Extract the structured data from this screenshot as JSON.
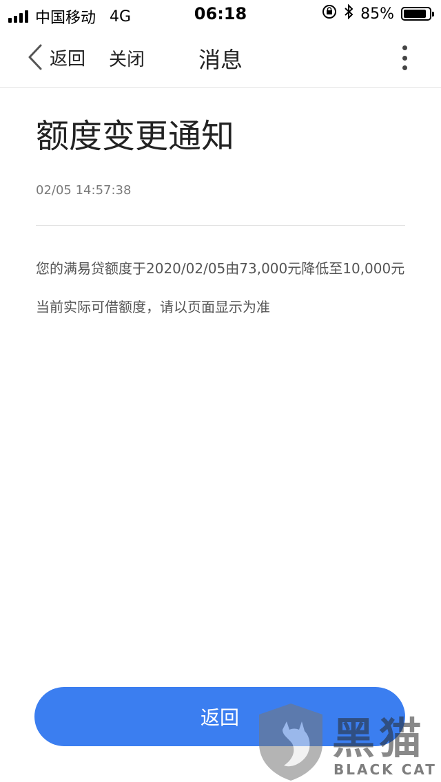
{
  "status_bar": {
    "carrier": "中国移动",
    "network": "4G",
    "time": "06:18",
    "battery_percent": "85%",
    "battery_level": 0.85
  },
  "nav": {
    "back_label": "返回",
    "close_label": "关闭",
    "title": "消息"
  },
  "message": {
    "title": "额度变更通知",
    "time": "02/05 14:57:38",
    "body": [
      "您的满易贷额度于2020/02/05由73,000元降低至10,000元",
      "当前实际可借额度，请以页面显示为准"
    ]
  },
  "footer": {
    "back_button_label": "返回"
  },
  "watermark": {
    "text_cn": "黑猫",
    "text_en": "BLACK CAT"
  },
  "colors": {
    "accent": "#3b7ef0"
  }
}
